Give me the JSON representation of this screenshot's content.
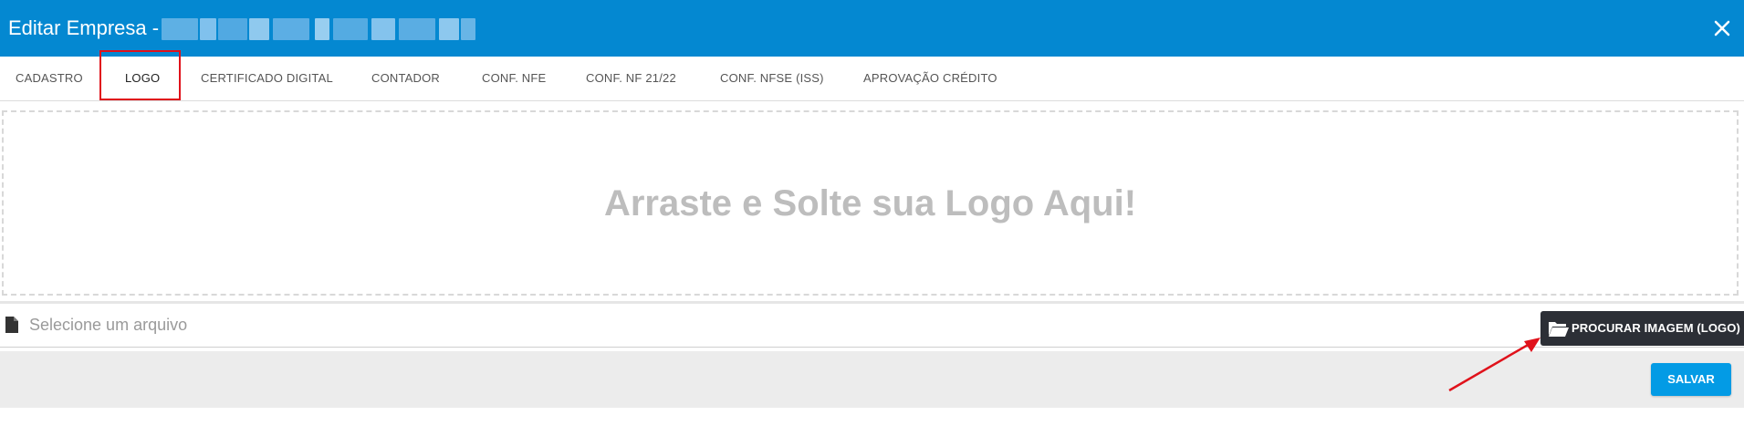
{
  "header": {
    "title": "Editar Empresa -",
    "background_color": "#0488d1",
    "close_icon": "close-icon"
  },
  "tabs": [
    {
      "label": "CADASTRO",
      "active": false
    },
    {
      "label": "LOGO",
      "active": true
    },
    {
      "label": "CERTIFICADO DIGITAL",
      "active": false
    },
    {
      "label": "CONTADOR",
      "active": false
    },
    {
      "label": "CONF. NFE",
      "active": false
    },
    {
      "label": "CONF. NF 21/22",
      "active": false
    },
    {
      "label": "CONF. NFSE (ISS)",
      "active": false
    },
    {
      "label": "APROVAÇÃO CRÉDITO",
      "active": false
    }
  ],
  "drop_zone": {
    "text": "Arraste e Solte sua Logo Aqui!"
  },
  "file_select": {
    "placeholder": "Selecione um arquivo",
    "value": "",
    "icon": "file-icon",
    "browse_label": "PROCURAR IMAGEM (LOGO)",
    "browse_icon": "folder-open-icon"
  },
  "footer": {
    "save_label": "SALVAR",
    "save_color": "#039be5"
  },
  "annotations": {
    "highlight_color": "#e0121b",
    "arrow_color": "#e0121b"
  }
}
